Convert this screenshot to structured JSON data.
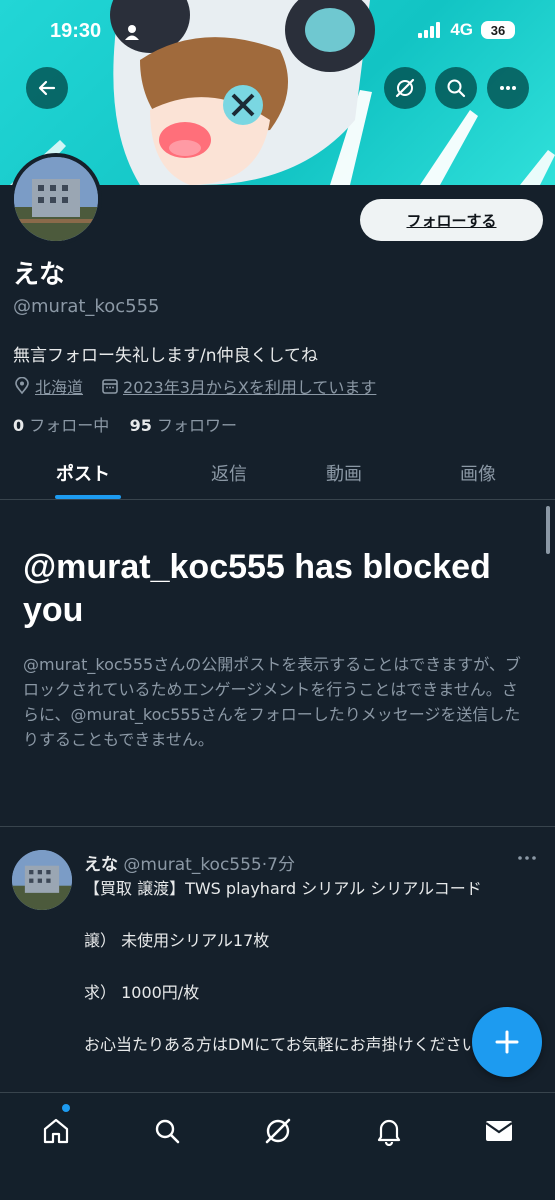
{
  "status_bar": {
    "time": "19:30",
    "network": "4G",
    "battery": "36"
  },
  "header": {
    "back_icon": "arrow-left-icon",
    "grok_icon": "grok-icon",
    "search_icon": "search-icon",
    "more_icon": "more-horizontal-icon"
  },
  "profile": {
    "display_name": "えな",
    "handle": "@murat_koc555",
    "follow_label": "フォローする",
    "bio": "無言フォロー失礼します/n仲良くしてね",
    "location": "北海道",
    "joined": "2023年3月からXを利用しています",
    "following_count": "0",
    "following_label": "フォロー中",
    "followers_count": "95",
    "followers_label": "フォロワー"
  },
  "tabs": [
    {
      "label": "ポスト",
      "active": true
    },
    {
      "label": "返信",
      "active": false
    },
    {
      "label": "動画",
      "active": false
    },
    {
      "label": "画像",
      "active": false
    }
  ],
  "blocked": {
    "title": "@murat_koc555 has blocked you",
    "description": "@murat_koc555さんの公開ポストを表示することはできますが、ブロックされているためエンゲージメントを行うことはできません。さらに、@murat_koc555さんをフォローしたりメッセージを送信したりすることもできません。"
  },
  "post": {
    "name": "えな",
    "handle_time": "@murat_koc555·7分",
    "lines": [
      "【買取 譲渡】TWS playhard シリアル シリアルコード",
      "譲） 未使用シリアル17枚",
      "求） 1000円/枚",
      "お心当たりある方はDMにてお気軽にお声掛けください"
    ]
  },
  "fab_icon": "plus-icon",
  "bottom_nav": [
    "home-icon",
    "search-icon",
    "grok-icon",
    "bell-icon",
    "mail-icon"
  ],
  "colors": {
    "accent": "#1d9bf0",
    "background": "#15202b",
    "banner": "#22d6d6"
  }
}
